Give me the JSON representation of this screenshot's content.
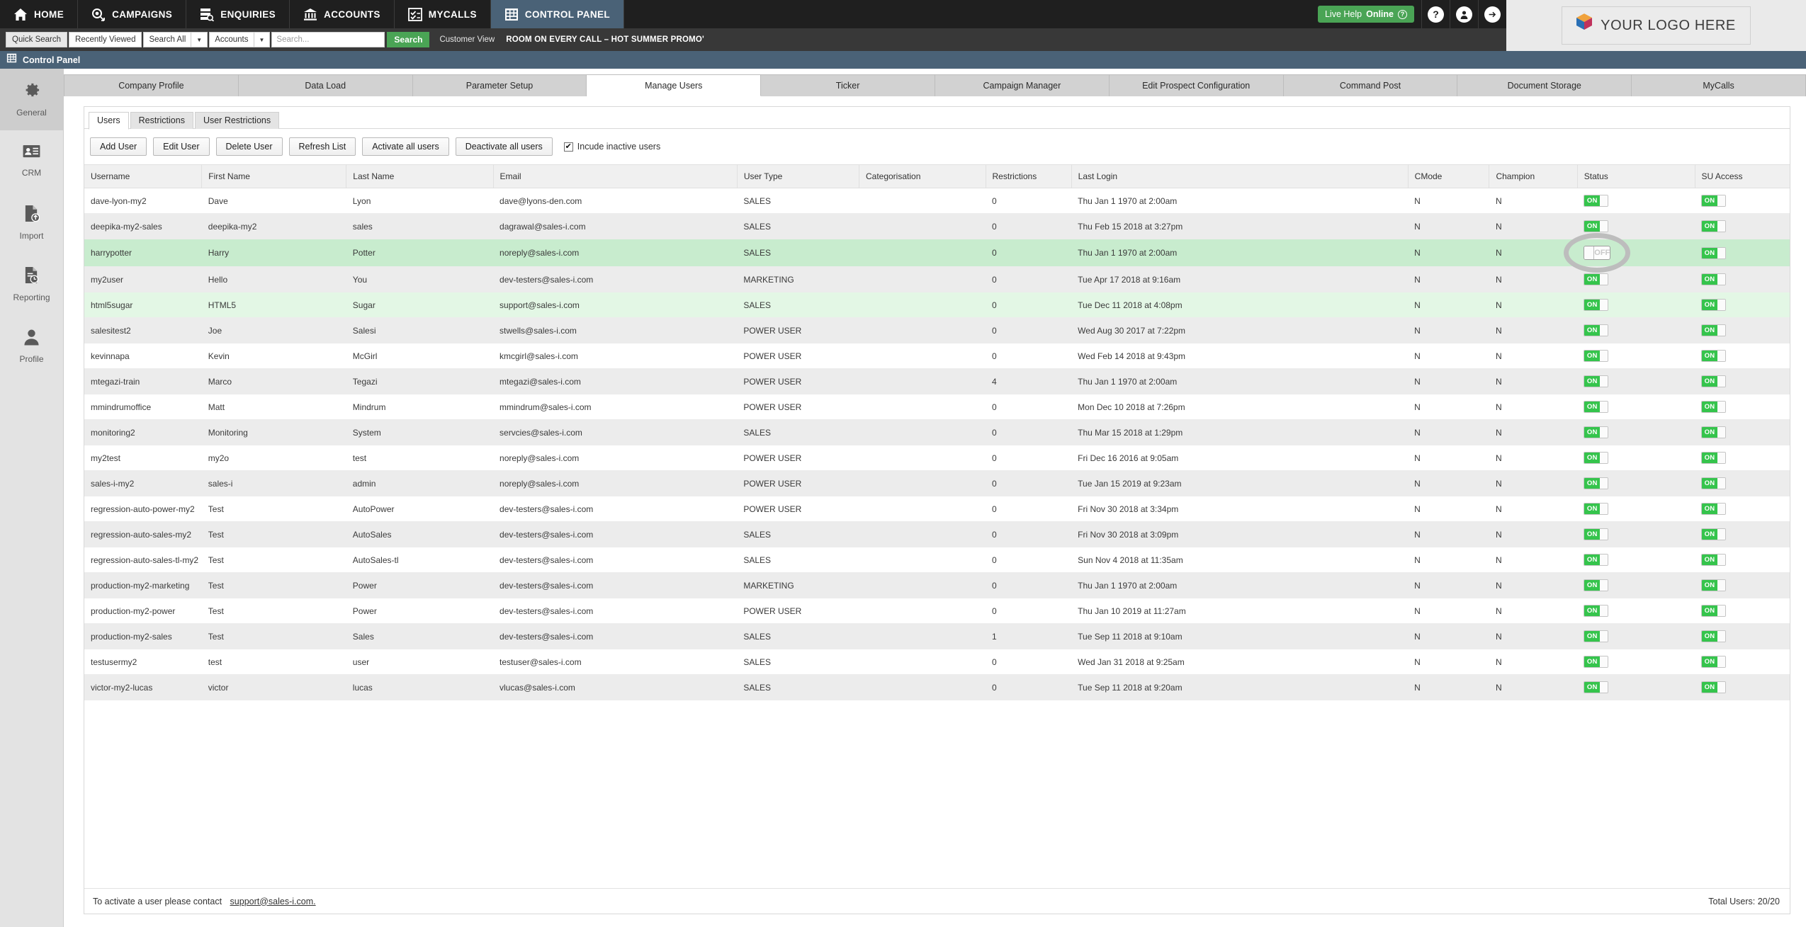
{
  "topnav": {
    "items": [
      {
        "label": "HOME",
        "icon": "home-icon",
        "active": false
      },
      {
        "label": "CAMPAIGNS",
        "icon": "megaphone-icon",
        "active": false
      },
      {
        "label": "ENQUIRIES",
        "icon": "enquiries-icon",
        "active": false
      },
      {
        "label": "ACCOUNTS",
        "icon": "bank-icon",
        "active": false
      },
      {
        "label": "MYCALLS",
        "icon": "checklist-icon",
        "active": false
      },
      {
        "label": "CONTROL PANEL",
        "icon": "control-panel-icon",
        "active": true
      }
    ],
    "live_help": {
      "prefix": "Live Help",
      "status": "Online",
      "icon": "question-circle-icon"
    },
    "help_icon": "question-mark-icon",
    "user_icon": "user-avatar-icon",
    "logout_icon": "arrow-right-icon",
    "accent_green": "#4aa455",
    "active_tab_bg": "#4a6277"
  },
  "logo": {
    "text": "YOUR LOGO HERE",
    "icon": "brand-cube-icon"
  },
  "search": {
    "quick_search": "Quick Search",
    "recently_viewed": "Recently Viewed",
    "scope_select": "Search All",
    "entity_select": "Accounts",
    "input_value": "",
    "placeholder": "Search...",
    "search_button": "Search",
    "customer_view": "Customer View",
    "promo": "ROOM ON EVERY CALL – HOT SUMMER PROMO'"
  },
  "control_panel_bar": {
    "title": "Control Panel",
    "icon": "control-panel-icon"
  },
  "sidebar": {
    "items": [
      {
        "label": "General",
        "icon": "gear-icon",
        "active": true
      },
      {
        "label": "CRM",
        "icon": "contact-card-icon",
        "active": false
      },
      {
        "label": "Import",
        "icon": "file-upload-icon",
        "active": false
      },
      {
        "label": "Reporting",
        "icon": "report-file-icon",
        "active": false
      },
      {
        "label": "Profile",
        "icon": "person-icon",
        "active": false
      }
    ]
  },
  "main_tabs": [
    {
      "label": "Company Profile",
      "active": false
    },
    {
      "label": "Data Load",
      "active": false
    },
    {
      "label": "Parameter Setup",
      "active": false
    },
    {
      "label": "Manage Users",
      "active": true
    },
    {
      "label": "Ticker",
      "active": false
    },
    {
      "label": "Campaign Manager",
      "active": false
    },
    {
      "label": "Edit Prospect Configuration",
      "active": false
    },
    {
      "label": "Command Post",
      "active": false
    },
    {
      "label": "Document Storage",
      "active": false
    },
    {
      "label": "MyCalls",
      "active": false
    }
  ],
  "sub_tabs": [
    {
      "label": "Users",
      "active": true
    },
    {
      "label": "Restrictions",
      "active": false
    },
    {
      "label": "User Restrictions",
      "active": false
    }
  ],
  "toolbar": {
    "buttons": [
      "Add User",
      "Edit User",
      "Delete User",
      "Refresh List",
      "Activate all users",
      "Deactivate all users"
    ],
    "checkbox": {
      "label": "Incude inactive users",
      "checked": true,
      "mark": "✔"
    }
  },
  "table": {
    "columns": [
      "Username",
      "First Name",
      "Last Name",
      "Email",
      "User Type",
      "Categorisation",
      "Restrictions",
      "Last Login",
      "CMode",
      "Champion",
      "Status",
      "SU Access"
    ],
    "rows": [
      {
        "username": "dave-lyon-my2",
        "first": "Dave",
        "last": "Lyon",
        "email": "dave@lyons-den.com",
        "type": "SALES",
        "categorisation": "",
        "restrictions": "0",
        "last_login": "Thu Jan 1 1970 at 2:00am",
        "cmode": "N",
        "champion": "N",
        "status": "ON",
        "su": "ON",
        "rowstyle": "r-white"
      },
      {
        "username": "deepika-my2-sales",
        "first": "deepika-my2",
        "last": "sales",
        "email": "dagrawal@sales-i.com",
        "type": "SALES",
        "categorisation": "",
        "restrictions": "0",
        "last_login": "Thu Feb 15 2018 at 3:27pm",
        "cmode": "N",
        "champion": "N",
        "status": "ON",
        "su": "ON",
        "rowstyle": "r-grey"
      },
      {
        "username": "harrypotter",
        "first": "Harry",
        "last": "Potter",
        "email": "noreply@sales-i.com",
        "type": "SALES",
        "categorisation": "",
        "restrictions": "0",
        "last_login": "Thu Jan 1 1970 at 2:00am",
        "cmode": "N",
        "champion": "N",
        "status": "OFF",
        "su": "ON",
        "rowstyle": "r-green"
      },
      {
        "username": "my2user",
        "first": "Hello",
        "last": "You",
        "email": "dev-testers@sales-i.com",
        "type": "MARKETING",
        "categorisation": "",
        "restrictions": "0",
        "last_login": "Tue Apr 17 2018 at 9:16am",
        "cmode": "N",
        "champion": "N",
        "status": "ON",
        "su": "ON",
        "rowstyle": "r-grey"
      },
      {
        "username": "html5sugar",
        "first": "HTML5",
        "last": "Sugar",
        "email": "support@sales-i.com",
        "type": "SALES",
        "categorisation": "",
        "restrictions": "0",
        "last_login": "Tue Dec 11 2018 at 4:08pm",
        "cmode": "N",
        "champion": "N",
        "status": "ON",
        "su": "ON",
        "rowstyle": "r-lgreen"
      },
      {
        "username": "salesitest2",
        "first": "Joe",
        "last": "Salesi",
        "email": "stwells@sales-i.com",
        "type": "POWER USER",
        "categorisation": "",
        "restrictions": "0",
        "last_login": "Wed Aug 30 2017 at 7:22pm",
        "cmode": "N",
        "champion": "N",
        "status": "ON",
        "su": "ON",
        "rowstyle": "r-grey"
      },
      {
        "username": "kevinnapa",
        "first": "Kevin",
        "last": "McGirl",
        "email": "kmcgirl@sales-i.com",
        "type": "POWER USER",
        "categorisation": "",
        "restrictions": "0",
        "last_login": "Wed Feb 14 2018 at 9:43pm",
        "cmode": "N",
        "champion": "N",
        "status": "ON",
        "su": "ON",
        "rowstyle": "r-white"
      },
      {
        "username": "mtegazi-train",
        "first": "Marco",
        "last": "Tegazi",
        "email": "mtegazi@sales-i.com",
        "type": "POWER USER",
        "categorisation": "",
        "restrictions": "4",
        "last_login": "Thu Jan 1 1970 at 2:00am",
        "cmode": "N",
        "champion": "N",
        "status": "ON",
        "su": "ON",
        "rowstyle": "r-grey"
      },
      {
        "username": "mmindrumoffice",
        "first": "Matt",
        "last": "Mindrum",
        "email": "mmindrum@sales-i.com",
        "type": "POWER USER",
        "categorisation": "",
        "restrictions": "0",
        "last_login": "Mon Dec 10 2018 at 7:26pm",
        "cmode": "N",
        "champion": "N",
        "status": "ON",
        "su": "ON",
        "rowstyle": "r-white"
      },
      {
        "username": "monitoring2",
        "first": "Monitoring",
        "last": "System",
        "email": "servcies@sales-i.com",
        "type": "SALES",
        "categorisation": "",
        "restrictions": "0",
        "last_login": "Thu Mar 15 2018 at 1:29pm",
        "cmode": "N",
        "champion": "N",
        "status": "ON",
        "su": "ON",
        "rowstyle": "r-grey"
      },
      {
        "username": "my2test",
        "first": "my2o",
        "last": "test",
        "email": "noreply@sales-i.com",
        "type": "POWER USER",
        "categorisation": "",
        "restrictions": "0",
        "last_login": "Fri Dec 16 2016 at 9:05am",
        "cmode": "N",
        "champion": "N",
        "status": "ON",
        "su": "ON",
        "rowstyle": "r-white"
      },
      {
        "username": "sales-i-my2",
        "first": "sales-i",
        "last": "admin",
        "email": "noreply@sales-i.com",
        "type": "POWER USER",
        "categorisation": "",
        "restrictions": "0",
        "last_login": "Tue Jan 15 2019 at 9:23am",
        "cmode": "N",
        "champion": "N",
        "status": "ON",
        "su": "ON",
        "rowstyle": "r-grey"
      },
      {
        "username": "regression-auto-power-my2",
        "first": "Test",
        "last": "AutoPower",
        "email": "dev-testers@sales-i.com",
        "type": "POWER USER",
        "categorisation": "",
        "restrictions": "0",
        "last_login": "Fri Nov 30 2018 at 3:34pm",
        "cmode": "N",
        "champion": "N",
        "status": "ON",
        "su": "ON",
        "rowstyle": "r-white"
      },
      {
        "username": "regression-auto-sales-my2",
        "first": "Test",
        "last": "AutoSales",
        "email": "dev-testers@sales-i.com",
        "type": "SALES",
        "categorisation": "",
        "restrictions": "0",
        "last_login": "Fri Nov 30 2018 at 3:09pm",
        "cmode": "N",
        "champion": "N",
        "status": "ON",
        "su": "ON",
        "rowstyle": "r-grey"
      },
      {
        "username": "regression-auto-sales-tl-my2",
        "first": "Test",
        "last": "AutoSales-tl",
        "email": "dev-testers@sales-i.com",
        "type": "SALES",
        "categorisation": "",
        "restrictions": "0",
        "last_login": "Sun Nov 4 2018 at 11:35am",
        "cmode": "N",
        "champion": "N",
        "status": "ON",
        "su": "ON",
        "rowstyle": "r-white"
      },
      {
        "username": "production-my2-marketing",
        "first": "Test",
        "last": "Power",
        "email": "dev-testers@sales-i.com",
        "type": "MARKETING",
        "categorisation": "",
        "restrictions": "0",
        "last_login": "Thu Jan 1 1970 at 2:00am",
        "cmode": "N",
        "champion": "N",
        "status": "ON",
        "su": "ON",
        "rowstyle": "r-grey"
      },
      {
        "username": "production-my2-power",
        "first": "Test",
        "last": "Power",
        "email": "dev-testers@sales-i.com",
        "type": "POWER USER",
        "categorisation": "",
        "restrictions": "0",
        "last_login": "Thu Jan 10 2019 at 11:27am",
        "cmode": "N",
        "champion": "N",
        "status": "ON",
        "su": "ON",
        "rowstyle": "r-white"
      },
      {
        "username": "production-my2-sales",
        "first": "Test",
        "last": "Sales",
        "email": "dev-testers@sales-i.com",
        "type": "SALES",
        "categorisation": "",
        "restrictions": "1",
        "last_login": "Tue Sep 11 2018 at 9:10am",
        "cmode": "N",
        "champion": "N",
        "status": "ON",
        "su": "ON",
        "rowstyle": "r-grey"
      },
      {
        "username": "testusermy2",
        "first": "test",
        "last": "user",
        "email": "testuser@sales-i.com",
        "type": "SALES",
        "categorisation": "",
        "restrictions": "0",
        "last_login": "Wed Jan 31 2018 at 9:25am",
        "cmode": "N",
        "champion": "N",
        "status": "ON",
        "su": "ON",
        "rowstyle": "r-white"
      },
      {
        "username": "victor-my2-lucas",
        "first": "victor",
        "last": "lucas",
        "email": "vlucas@sales-i.com",
        "type": "SALES",
        "categorisation": "",
        "restrictions": "0",
        "last_login": "Tue Sep 11 2018 at 9:20am",
        "cmode": "N",
        "champion": "N",
        "status": "ON",
        "su": "ON",
        "rowstyle": "r-grey"
      }
    ]
  },
  "footer": {
    "activate_text": "To activate a user please contact",
    "support_email": "support@sales-i.com.",
    "total_users": "Total Users: 20/20"
  }
}
